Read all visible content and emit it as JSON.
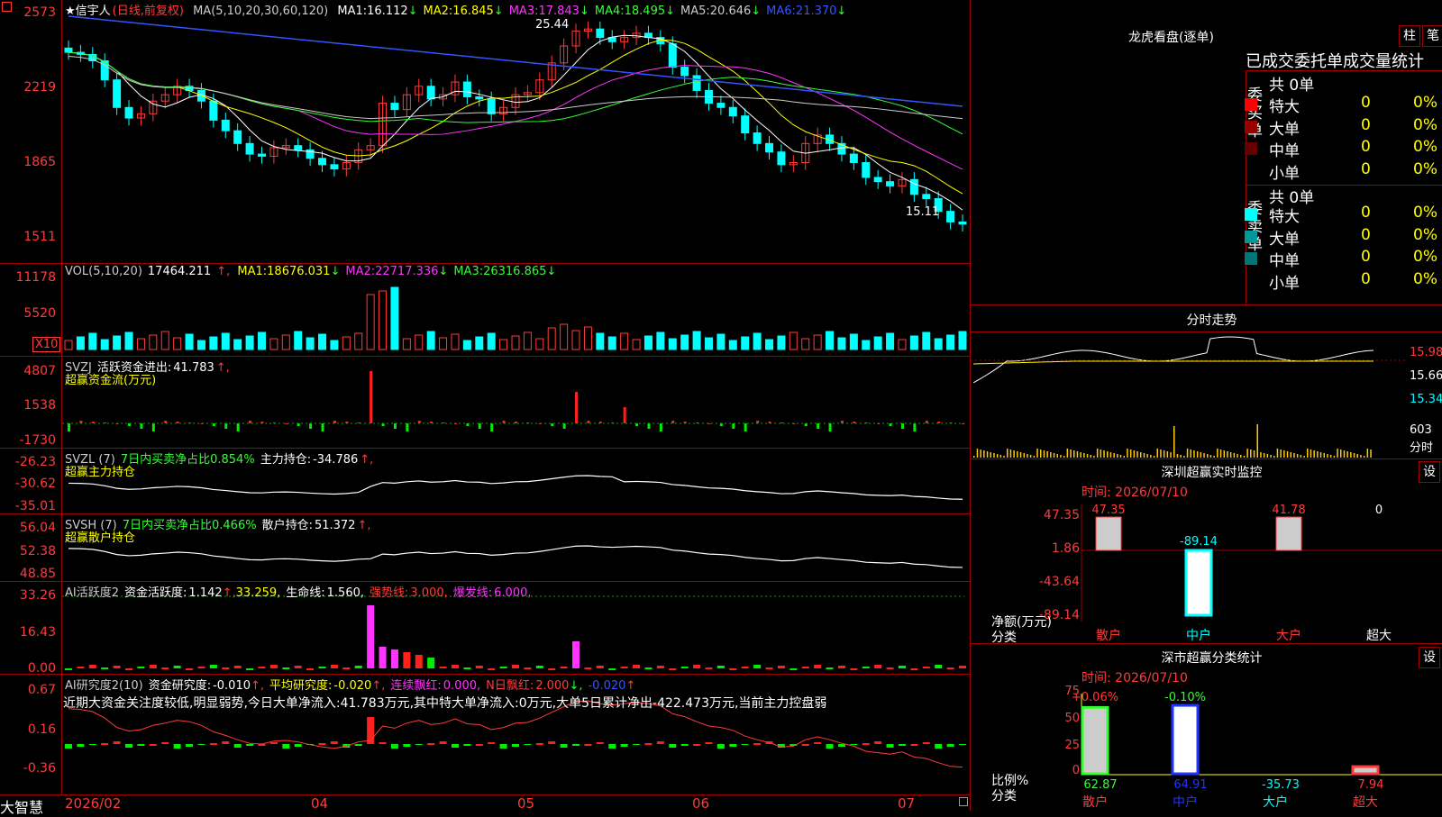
{
  "app": {
    "brand": "大智慧"
  },
  "main": {
    "stock_name": "★信宇人",
    "period": "(日线,前复权)",
    "ma_label": "MA(5,10,20,30,60,120)",
    "ma": [
      {
        "label": "MA1:",
        "value": "16.112",
        "arrow": "↓",
        "color": "#ffffff"
      },
      {
        "label": "MA2:",
        "value": "16.845",
        "arrow": "↓",
        "color": "#ffff00"
      },
      {
        "label": "MA3:",
        "value": "17.843",
        "arrow": "↓",
        "color": "#ff33ff"
      },
      {
        "label": "MA4:",
        "value": "18.495",
        "arrow": "↓",
        "color": "#33ff33"
      },
      {
        "label": "MA5:",
        "value": "20.646",
        "arrow": "↓",
        "color": "#cccccc"
      },
      {
        "label": "MA6:",
        "value": "21.370",
        "arrow": "↓",
        "color": "#3355ff"
      }
    ],
    "y_ticks": [
      "2573",
      "2219",
      "1865",
      "1511"
    ],
    "high_label": "25.44",
    "low_label": "15.11"
  },
  "vol": {
    "label": "VOL(5,10,20)",
    "value": "17464.211",
    "ma": [
      {
        "label": "MA1:",
        "value": "18676.031",
        "arrow": "↓",
        "color": "#ffff00"
      },
      {
        "label": "MA2:",
        "value": "22717.336",
        "arrow": "↓",
        "color": "#ff33ff"
      },
      {
        "label": "MA3:",
        "value": "26316.865",
        "arrow": "↓",
        "color": "#33ff33"
      }
    ],
    "y_ticks": [
      "11178",
      "5520"
    ],
    "unit": "X10"
  },
  "svzj": {
    "label": "SVZJ",
    "text": "活跃资金进出:",
    "value": "41.783",
    "arrow": "↑,",
    "subtitle": "超赢资金流(万元)",
    "y_ticks": [
      "4807",
      "1538",
      "-1730"
    ]
  },
  "svzl": {
    "label": "SVZL (7)",
    "text1": "7日内买卖净占比0.854%",
    "text2": "主力持仓:",
    "value": "-34.786",
    "arrow": "↑,",
    "subtitle": "超赢主力持仓",
    "y_ticks": [
      "-26.23",
      "-30.62",
      "-35.01"
    ]
  },
  "svsh": {
    "label": "SVSH (7)",
    "text1": "7日内买卖净占比0.466%",
    "text2": "散户持仓:",
    "value": "51.372",
    "arrow": "↑,",
    "subtitle": "超赢散户持仓",
    "y_ticks": [
      "56.04",
      "52.38",
      "48.85"
    ]
  },
  "ai1": {
    "label": "AI活跃度2",
    "text": "资金活跃度:",
    "value": "1.142",
    "arrow": "↑,",
    "v2": "33.259,",
    "t3": "生命线:",
    "v3": "1.560,",
    "t4": "强势线:",
    "v4": "3.000,",
    "t5": "爆发线:",
    "v5": "6.000,",
    "y_ticks": [
      "33.26",
      "16.43",
      "0.00"
    ]
  },
  "ai2": {
    "label": "AI研究度2(10)",
    "text": "资金研究度:",
    "value": "-0.010",
    "arrow": "↑,",
    "t2": "平均研究度:",
    "v2": "-0.020",
    "a2": "↑,",
    "t3": "连续飘红:",
    "v3": "0.000,",
    "t4": "N日飘红:",
    "v4": "2.000",
    "a4": "↓,",
    "v5": "-0.020",
    "a5": "↑",
    "comment": "近期大资金关注度较低,明显弱势,今日大单净流入:41.783万元,其中特大单净流入:0万元,大单5日累计净出-422.473万元,当前主力控盘弱",
    "y_ticks": [
      "0.67",
      "0.16",
      "-0.36"
    ]
  },
  "dates": [
    "2026/02",
    "04",
    "05",
    "06",
    "07"
  ],
  "right": {
    "dragon_title": "龙虎看盘(逐单)",
    "btn_bar": "柱",
    "btn_pen": "笔",
    "tabs": [
      "已成交",
      "委托单",
      "成交量统计"
    ],
    "buy": {
      "side": "委买单",
      "total": "共 0单",
      "rows": [
        {
          "name": "特大",
          "count": "0",
          "pct": "0%",
          "color": "#ff0000"
        },
        {
          "name": "大单",
          "count": "0",
          "pct": "0%",
          "color": "#990000"
        },
        {
          "name": "中单",
          "count": "0",
          "pct": "0%",
          "color": "#660000"
        },
        {
          "name": "小单",
          "count": "0",
          "pct": "0%",
          "color": ""
        }
      ]
    },
    "sell": {
      "side": "委卖单",
      "total": "共 0单",
      "rows": [
        {
          "name": "特大",
          "count": "0",
          "pct": "0%",
          "color": "#00ffff"
        },
        {
          "name": "大单",
          "count": "0",
          "pct": "0%",
          "color": "#009999"
        },
        {
          "name": "中单",
          "count": "0",
          "pct": "0%",
          "color": "#007777"
        },
        {
          "name": "小单",
          "count": "0",
          "pct": "0%",
          "color": ""
        }
      ]
    },
    "intraday": {
      "title": "分时走势",
      "prices": [
        "15.98",
        "15.66",
        "15.34"
      ],
      "vol": "603",
      "vol_unit": "分时"
    },
    "monitor": {
      "title": "深圳超赢实时监控",
      "btn": "设",
      "time": "时间: 2026/07/10",
      "y_ticks": [
        "47.35",
        "1.86",
        "-43.64",
        "-89.14"
      ],
      "ylabel": "净额(万元)",
      "xlabel": "分类",
      "bars": [
        {
          "cat": "散户",
          "value": "47.35"
        },
        {
          "cat": "中户",
          "value": "-89.14"
        },
        {
          "cat": "大户",
          "value": "41.78"
        },
        {
          "cat": "超大",
          "value": "0"
        }
      ]
    },
    "classify": {
      "title": "深市超赢分类统计",
      "btn": "设",
      "time": "时间: 2026/07/10",
      "y_ticks": [
        "75",
        "50",
        "25",
        "0"
      ],
      "ylabel": "比例%",
      "xlabel": "分类",
      "bars": [
        {
          "cat": "散户",
          "top": "+0.06%",
          "bottom": "62.87"
        },
        {
          "cat": "中户",
          "top": "-0.10%",
          "bottom": "64.91"
        },
        {
          "cat": "大户",
          "top": "",
          "bottom": "-35.73"
        },
        {
          "cat": "超大",
          "top": "",
          "bottom": "7.94"
        }
      ]
    }
  },
  "chart_data": [
    {
      "type": "candlestick",
      "title": "信宇人 (日线,前复权)",
      "ylim": [
        15.11,
        25.73
      ],
      "x": [
        "2026/02",
        "04",
        "05",
        "06",
        "07"
      ],
      "values": [
        23.9,
        23.8,
        23.5,
        22.6,
        21.3,
        20.8,
        21.0,
        21.6,
        21.9,
        22.3,
        22.1,
        21.6,
        20.7,
        20.2,
        19.6,
        19.1,
        19.0,
        19.4,
        19.5,
        19.3,
        18.9,
        18.6,
        18.4,
        18.7,
        19.3,
        19.5,
        21.5,
        21.2,
        21.9,
        22.3,
        21.7,
        21.9,
        22.5,
        21.8,
        21.7,
        21.0,
        21.3,
        21.9,
        22.0,
        22.6,
        23.4,
        24.2,
        24.9,
        25.0,
        24.6,
        24.4,
        24.6,
        24.8,
        24.6,
        24.3,
        23.2,
        22.8,
        22.1,
        21.5,
        21.3,
        20.9,
        20.1,
        19.6,
        19.2,
        18.6,
        18.7,
        19.6,
        20.0,
        19.6,
        19.1,
        18.7,
        18.0,
        17.8,
        17.6,
        17.9,
        17.2,
        17.0,
        16.4,
        15.9,
        15.8
      ]
    },
    {
      "type": "bar",
      "title": "VOL(5,10,20)",
      "ylim": [
        0,
        11178
      ]
    },
    {
      "type": "bar",
      "title": "SVZJ 活跃资金进出",
      "ylim": [
        -1730,
        4807
      ]
    },
    {
      "type": "line",
      "title": "SVZL 主力持仓",
      "ylim": [
        -35.01,
        -26.23
      ]
    },
    {
      "type": "line",
      "title": "SVSH 散户持仓",
      "ylim": [
        48.85,
        56.04
      ]
    },
    {
      "type": "bar",
      "title": "AI活跃度2",
      "ylim": [
        0,
        33.26
      ]
    },
    {
      "type": "bar",
      "title": "AI研究度2(10)",
      "ylim": [
        -0.36,
        0.67
      ]
    },
    {
      "type": "bar",
      "title": "深圳超赢实时监控",
      "categories": [
        "散户",
        "中户",
        "大户",
        "超大"
      ],
      "values": [
        47.35,
        -89.14,
        41.78,
        0
      ]
    },
    {
      "type": "bar",
      "title": "深市超赢分类统计",
      "categories": [
        "散户",
        "中户",
        "大户",
        "超大"
      ],
      "values": [
        62.87,
        64.91,
        -35.73,
        7.94
      ]
    }
  ]
}
